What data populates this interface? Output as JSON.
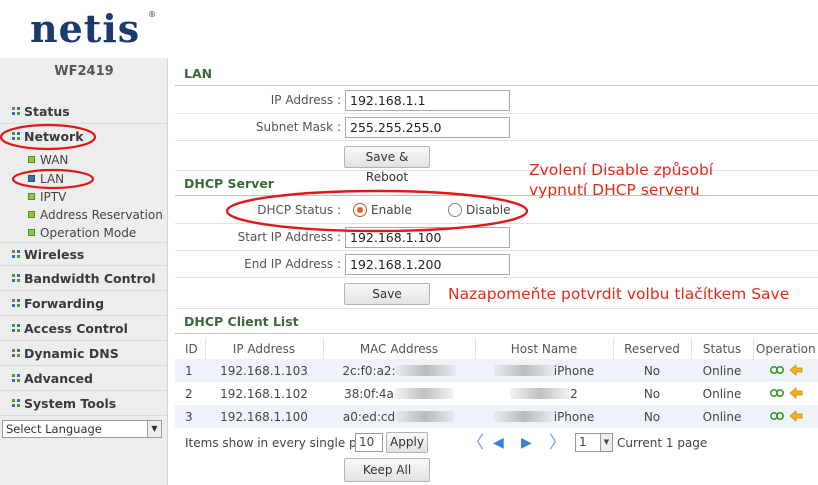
{
  "brand": {
    "logo": "netis",
    "reg": "®",
    "model": "WF2419"
  },
  "sidebar": {
    "items": [
      {
        "label": "Status"
      },
      {
        "label": "Network"
      },
      {
        "label": "Wireless"
      },
      {
        "label": "Bandwidth Control"
      },
      {
        "label": "Forwarding"
      },
      {
        "label": "Access Control"
      },
      {
        "label": "Dynamic DNS"
      },
      {
        "label": "Advanced"
      },
      {
        "label": "System Tools"
      }
    ],
    "network_sub": [
      {
        "label": "WAN"
      },
      {
        "label": "LAN"
      },
      {
        "label": "IPTV"
      },
      {
        "label": "Address Reservation"
      },
      {
        "label": "Operation Mode"
      }
    ],
    "language": "Select Language"
  },
  "lan": {
    "title": "LAN",
    "ip_label": "IP Address :",
    "ip_value": "192.168.1.1",
    "mask_label": "Subnet Mask :",
    "mask_value": "255.255.255.0",
    "button": "Save & Reboot"
  },
  "dhcp": {
    "title": "DHCP Server",
    "status_label": "DHCP Status :",
    "enable": "Enable",
    "disable": "Disable",
    "start_label": "Start IP Address :",
    "start_value": "192.168.1.100",
    "end_label": "End IP Address :",
    "end_value": "192.168.1.200",
    "button": "Save"
  },
  "annotations": {
    "note1_line1": "Zvolení Disable způsobí",
    "note1_line2": "vypnutí DHCP serveru",
    "note2": "Nazapomeňte potvrdit volbu tlačítkem Save"
  },
  "clients": {
    "title": "DHCP Client List",
    "columns": [
      "ID",
      "IP Address",
      "MAC Address",
      "Host Name",
      "Reserved",
      "Status",
      "Operation"
    ],
    "rows": [
      {
        "id": "1",
        "ip": "192.168.1.103",
        "mac": "2c:f0:a2:",
        "host": "iPhone",
        "reserved": "No",
        "status": "Online"
      },
      {
        "id": "2",
        "ip": "192.168.1.102",
        "mac": "38:0f:4a",
        "host": "2",
        "reserved": "No",
        "status": "Online"
      },
      {
        "id": "3",
        "ip": "192.168.1.100",
        "mac": "a0:ed:cd",
        "host": "iPhone",
        "reserved": "No",
        "status": "Online"
      }
    ],
    "pager_label": "Items show in every single page",
    "per_page": "10",
    "apply": "Apply",
    "page": "1",
    "current": "Current 1 page",
    "keep_all": "Keep All"
  },
  "colors": {
    "accent": "#3a6a3a",
    "annotation": "#e22a1a",
    "radio_on": "#e0621e"
  }
}
